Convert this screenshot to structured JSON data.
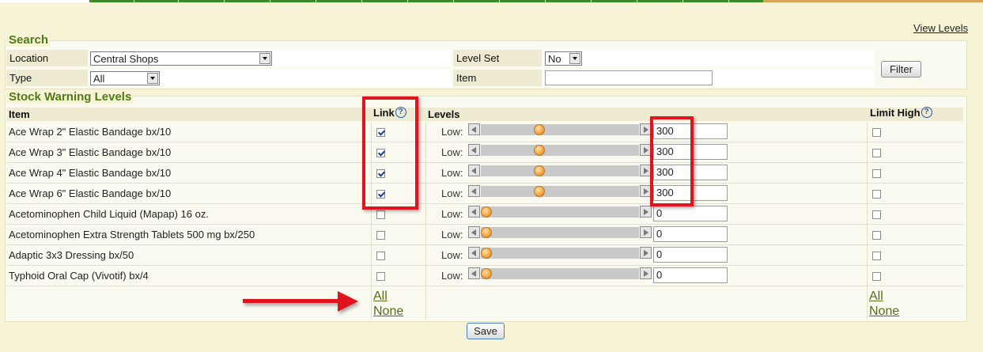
{
  "header": {
    "view_levels_link": "View Levels"
  },
  "search": {
    "title": "Search",
    "location_label": "Location",
    "location_value": "Central Shops",
    "type_label": "Type",
    "type_value": "All",
    "level_set_label": "Level Set",
    "level_set_value": "No",
    "item_label": "Item",
    "item_value": "",
    "filter_button": "Filter"
  },
  "stock": {
    "title": "Stock Warning Levels",
    "col_item": "Item",
    "col_link": "Link",
    "col_levels": "Levels",
    "col_limit_high": "Limit High",
    "help_glyph": "?",
    "low_label": "Low:",
    "rows": [
      {
        "item": "Ace Wrap 2\" Elastic Bandage bx/10",
        "link_checked": true,
        "level": "300",
        "slider_pos": 0.36,
        "limit_high": false
      },
      {
        "item": "Ace Wrap 3\" Elastic Bandage bx/10",
        "link_checked": true,
        "level": "300",
        "slider_pos": 0.36,
        "limit_high": false
      },
      {
        "item": "Ace Wrap 4\" Elastic Bandage bx/10",
        "link_checked": true,
        "level": "300",
        "slider_pos": 0.36,
        "limit_high": false
      },
      {
        "item": "Ace Wrap 6\" Elastic Bandage bx/10",
        "link_checked": true,
        "level": "300",
        "slider_pos": 0.36,
        "limit_high": false
      },
      {
        "item": "Acetominophen Child Liquid (Mapap) 16 oz.",
        "link_checked": false,
        "level": "0",
        "slider_pos": 0.0,
        "limit_high": false
      },
      {
        "item": "Acetominophen Extra Strength Tablets 500 mg bx/250",
        "link_checked": false,
        "level": "0",
        "slider_pos": 0.0,
        "limit_high": false
      },
      {
        "item": "Adaptic 3x3 Dressing bx/50",
        "link_checked": false,
        "level": "0",
        "slider_pos": 0.0,
        "limit_high": false
      },
      {
        "item": "Typhoid Oral Cap (Vivotif) bx/4",
        "link_checked": false,
        "level": "0",
        "slider_pos": 0.0,
        "limit_high": false
      }
    ],
    "link_all": "All",
    "link_none": "None",
    "limit_all": "All",
    "limit_none": "None"
  },
  "footer": {
    "save_button": "Save"
  },
  "colors": {
    "accent_green": "#4f7a18",
    "annotation_red": "#e0141e",
    "page_bg": "#f7f3d6"
  }
}
